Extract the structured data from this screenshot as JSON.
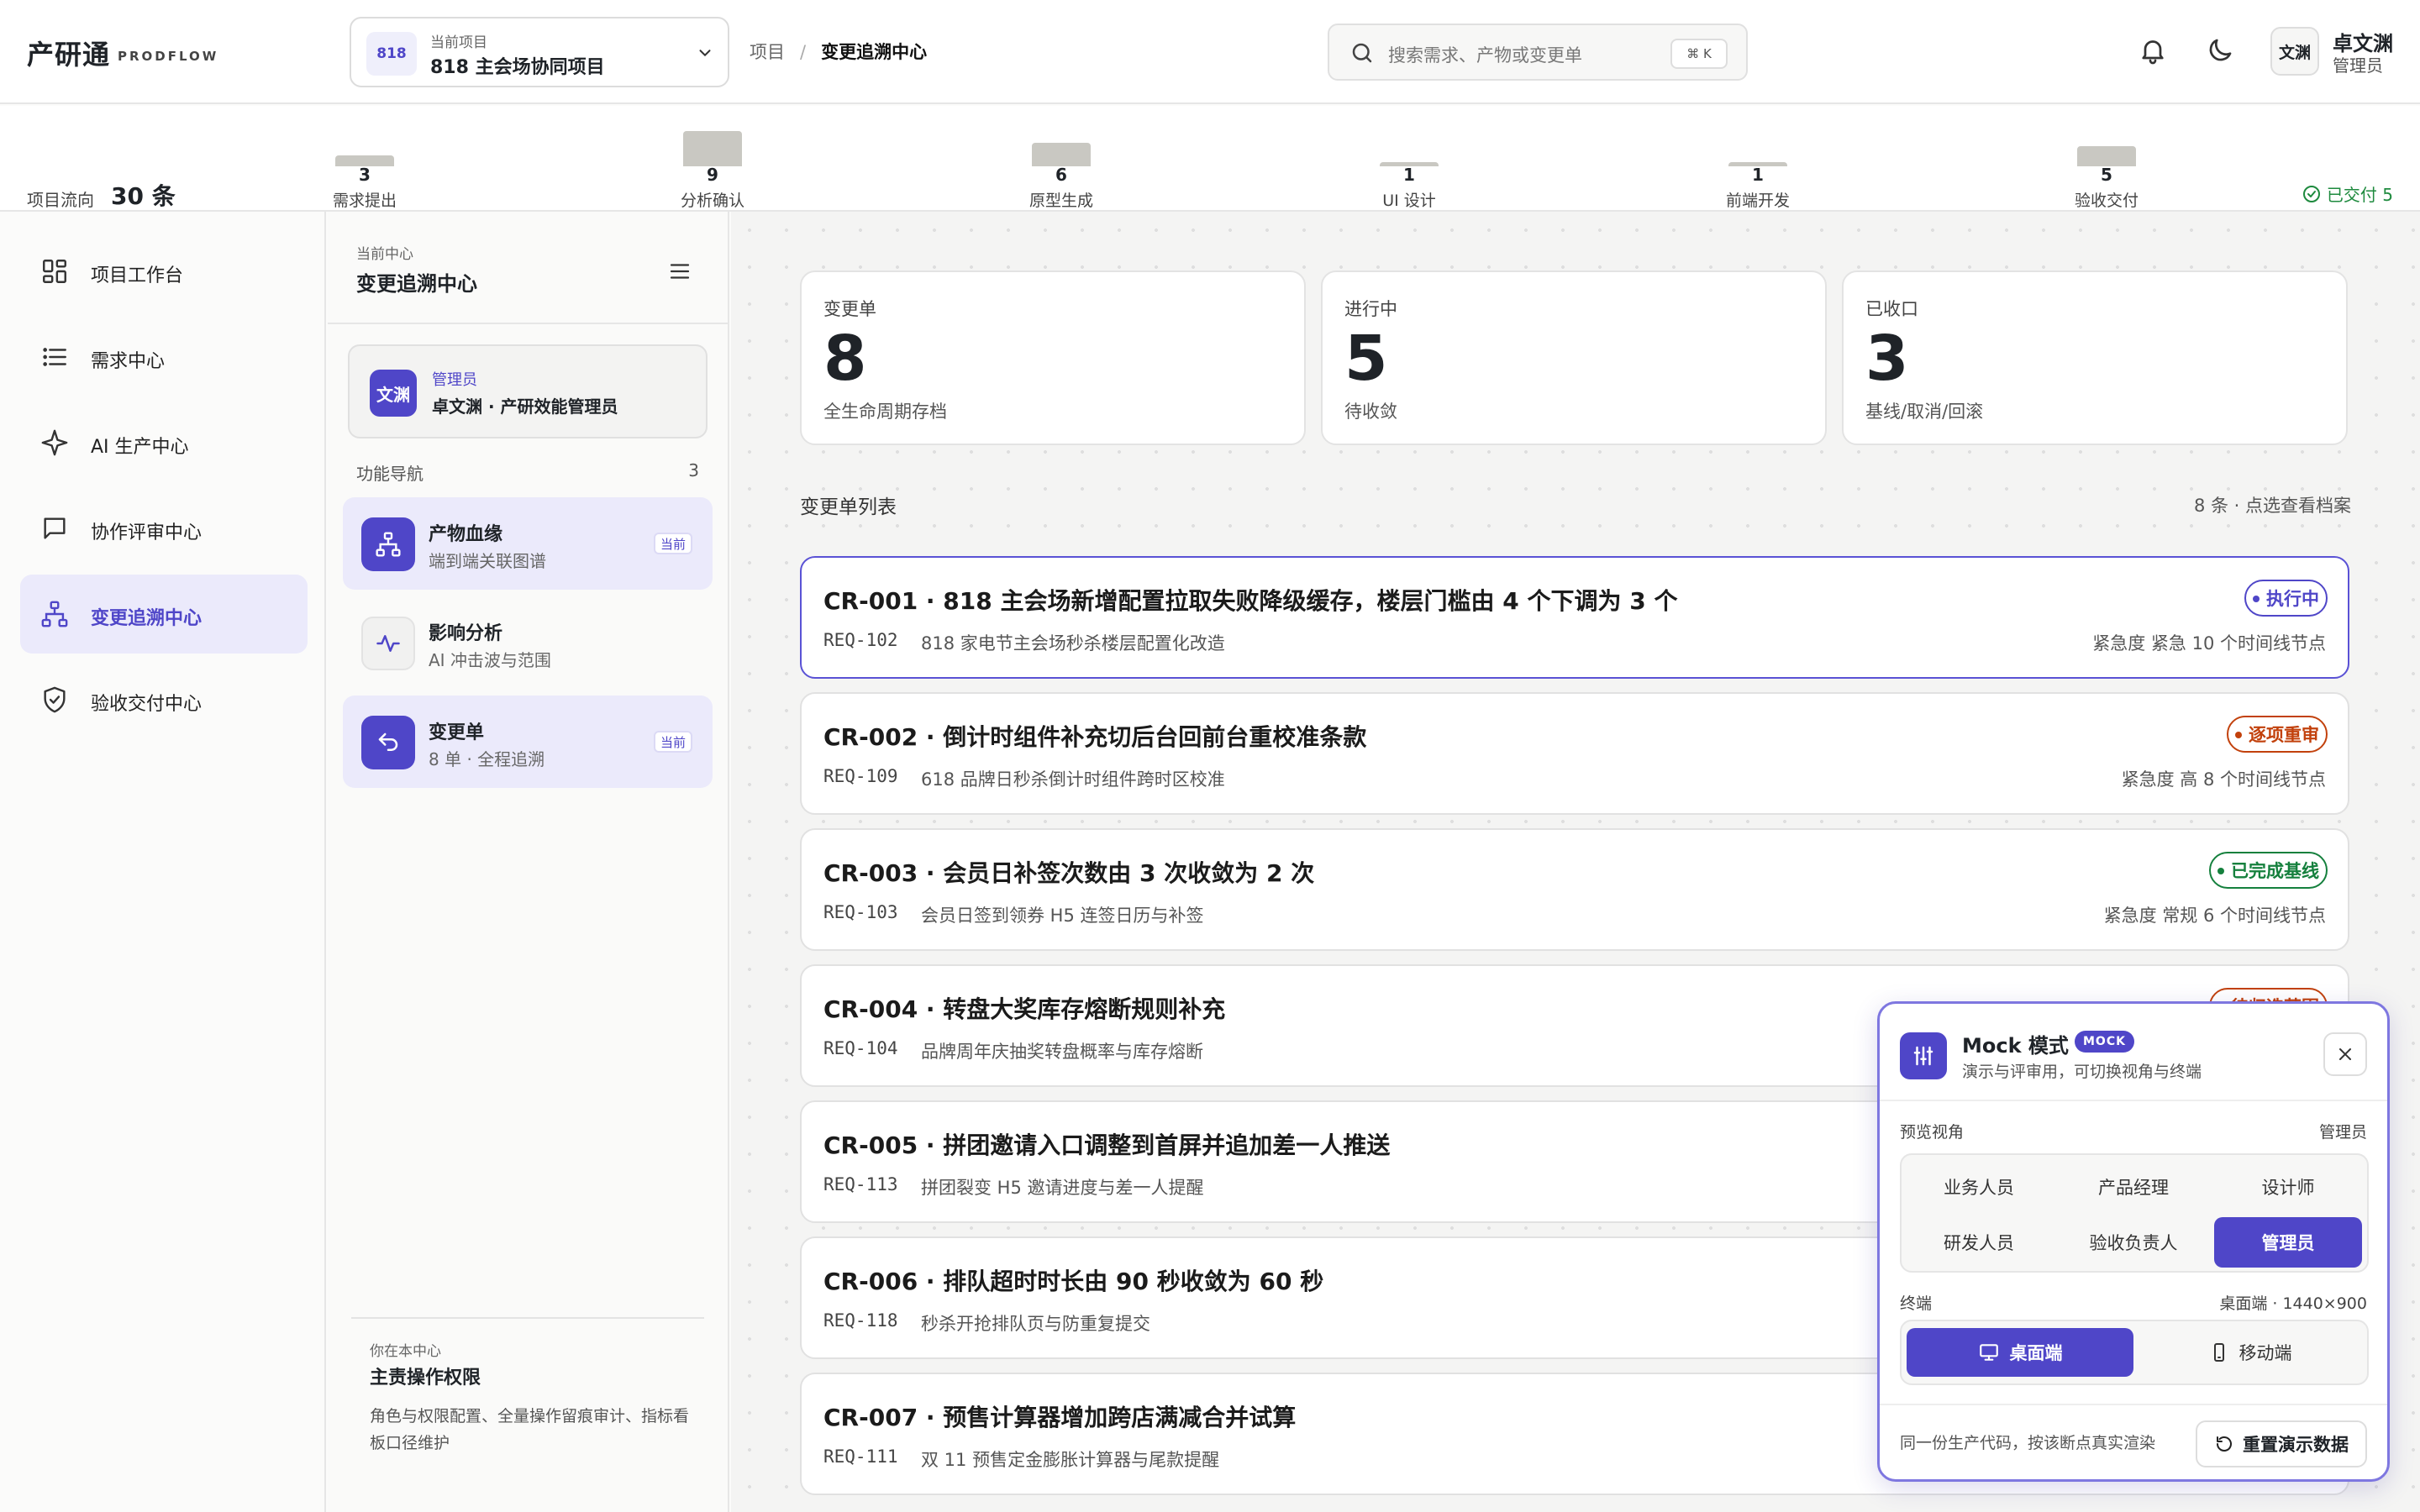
{
  "header": {
    "logo": "产研通",
    "logo_sub": "PRODFLOW",
    "project": {
      "badge": "818",
      "caption": "当前项目",
      "name": "818 主会场协同项目"
    },
    "breadcrumb": {
      "root": "项目",
      "sep": "/",
      "current": "变更追溯中心"
    },
    "search": {
      "placeholder": "搜索需求、产物或变更单",
      "shortcut": "⌘ K"
    },
    "user": {
      "avatar": "文渊",
      "name": "卓文渊",
      "role": "管理员"
    }
  },
  "flow": {
    "label": "项目流向",
    "count": "30 条",
    "stages": [
      {
        "name": "需求提出",
        "count": "3",
        "level": 0.3
      },
      {
        "name": "分析确认",
        "count": "9",
        "level": 1.0
      },
      {
        "name": "原型生成",
        "count": "6",
        "level": 0.67
      },
      {
        "name": "UI 设计",
        "count": "1",
        "level": 0.11
      },
      {
        "name": "前端开发",
        "count": "1",
        "level": 0.11
      },
      {
        "name": "验收交付",
        "count": "5",
        "level": 0.56
      }
    ],
    "delivered": "已交付 5"
  },
  "sidebar": {
    "items": [
      {
        "label": "项目工作台",
        "icon": "dashboard-icon"
      },
      {
        "label": "需求中心",
        "icon": "list-icon"
      },
      {
        "label": "AI 生产中心",
        "icon": "sparkle-icon"
      },
      {
        "label": "协作评审中心",
        "icon": "chat-icon"
      },
      {
        "label": "变更追溯中心",
        "icon": "hierarchy-icon",
        "active": true
      },
      {
        "label": "验收交付中心",
        "icon": "shield-icon"
      }
    ]
  },
  "subpanel": {
    "caption": "当前中心",
    "title": "变更追溯中心",
    "user_card": {
      "avatar": "文渊",
      "role": "管理员",
      "name": "卓文渊 · 产研效能管理员"
    },
    "nav_label": "功能导航",
    "nav_count": "3",
    "items": [
      {
        "title": "产物血缘",
        "sub": "端到端关联图谱",
        "tag": "当前",
        "icon": "lineage-icon"
      },
      {
        "title": "影响分析",
        "sub": "AI 冲击波与范围",
        "tag": "",
        "icon": "pulse-icon"
      },
      {
        "title": "变更单",
        "sub": "8 单 · 全程追溯",
        "tag": "当前",
        "icon": "undo-icon"
      }
    ],
    "perm": {
      "caption": "你在本中心",
      "title": "主责操作权限",
      "desc": "角色与权限配置、全量操作留痕审计、指标看板口径维护"
    }
  },
  "main": {
    "stats": [
      {
        "label": "变更单",
        "value": "8",
        "sub": "全生命周期存档"
      },
      {
        "label": "进行中",
        "value": "5",
        "sub": "待收敛"
      },
      {
        "label": "已收口",
        "value": "3",
        "sub": "基线/取消/回滚"
      }
    ],
    "list_title": "变更单列表",
    "list_meta": "8 条 · 点选查看档案",
    "changes": [
      {
        "title": "CR-001 · 818 主会场新增配置拉取失败降级缓存，楼层门槛由 4 个下调为 3 个",
        "req": "REQ-102",
        "desc": "818 家电节主会场秒杀楼层配置化改造",
        "meta": "紧急度 紧急   10 个时间线节点",
        "status": "执行中",
        "status_color": "#4f46c8"
      },
      {
        "title": "CR-002 · 倒计时组件补充切后台回前台重校准条款",
        "req": "REQ-109",
        "desc": "618 品牌日秒杀倒计时组件跨时区校准",
        "meta": "紧急度 高   8 个时间线节点",
        "status": "逐项重审",
        "status_color": "#c2410c"
      },
      {
        "title": "CR-003 · 会员日补签次数由 3 次收敛为 2 次",
        "req": "REQ-103",
        "desc": "会员日签到领券 H5 连签日历与补签",
        "meta": "紧急度 常规   6 个时间线节点",
        "status": "已完成基线",
        "status_color": "#15803d"
      },
      {
        "title": "CR-004 · 转盘大奖库存熔断规则补充",
        "req": "REQ-104",
        "desc": "品牌周年庆抽奖转盘概率与库存熔断",
        "meta": "",
        "status": "待归选范围",
        "status_color": "#c2410c"
      },
      {
        "title": "CR-005 · 拼团邀请入口调整到首屏并追加差一人推送",
        "req": "REQ-113",
        "desc": "拼团裂变 H5 邀请进度与差一人提醒",
        "meta": "",
        "status": "",
        "status_color": "#4f46c8"
      },
      {
        "title": "CR-006 · 排队超时时长由 90 秒收敛为 60 秒",
        "req": "REQ-118",
        "desc": "秒杀开抢排队页与防重复提交",
        "meta": "",
        "status": "",
        "status_color": "#4f46c8"
      },
      {
        "title": "CR-007 · 预售计算器增加跨店满减合并试算",
        "req": "REQ-111",
        "desc": "双 11 预售定金膨胀计算器与尾款提醒",
        "meta": "",
        "status": "",
        "status_color": "#4f46c8"
      }
    ]
  },
  "mock": {
    "title": "Mock 模式",
    "badge": "MOCK",
    "subtitle": "演示与评审用，可切换视角与终端",
    "view_label": "预览视角",
    "view_value": "管理员",
    "roles": [
      "业务人员",
      "产品经理",
      "设计师",
      "研发人员",
      "验收负责人",
      "管理员"
    ],
    "active_role": "管理员",
    "terminal_label": "终端",
    "terminal_value": "桌面端 · 1440×900",
    "terminals": [
      "桌面端",
      "移动端"
    ],
    "footer": "同一份生产代码，按该断点真实渲染",
    "reset": "重置演示数据"
  },
  "colors": {
    "accent": "#4f46c8",
    "accent_soft": "#ebeafb",
    "success": "#15803d",
    "warning": "#c2410c"
  }
}
